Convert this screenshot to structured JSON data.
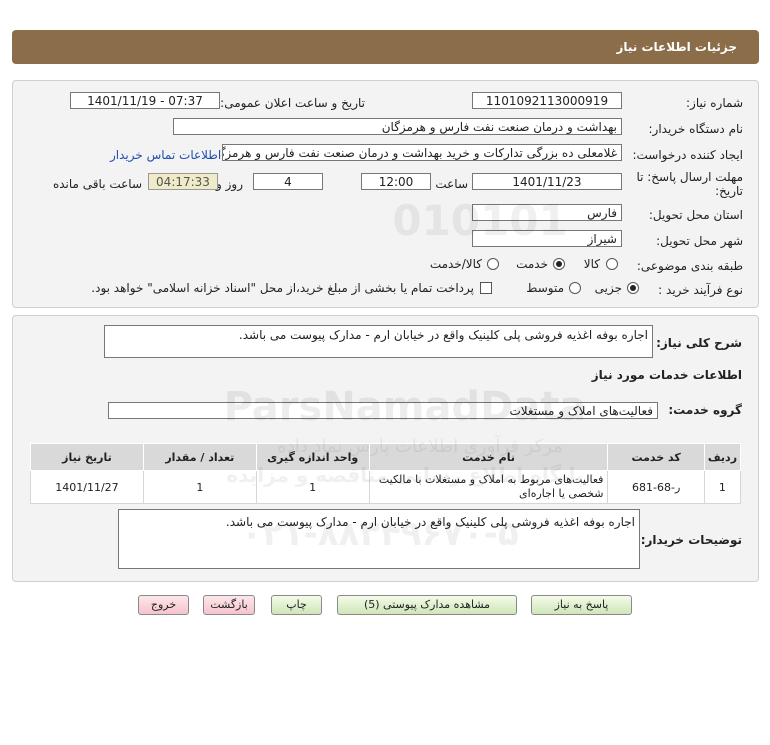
{
  "page": {
    "title": "جزئیات اطلاعات نیاز"
  },
  "form": {
    "need_number_label": "شماره نیاز:",
    "need_number": "1101092113000919",
    "announce_label": "تاریخ و ساعت اعلان عمومی:",
    "announce_value": "1401/11/19 - 07:37",
    "buyer_org_label": "نام دستگاه خریدار:",
    "buyer_org": "بهداشت و درمان صنعت نفت فارس و هرمزگان",
    "creator_label": "ایجاد کننده درخواست:",
    "creator": "غلامعلی ده بزرگی تدارکات و خرید بهداشت و درمان صنعت نفت فارس و هرمزگان",
    "contact_link": "اطلاعات تماس خریدار",
    "deadline_label_1": "مهلت ارسال پاسخ: تا",
    "deadline_label_2": "تاریخ:",
    "deadline_date": "1401/11/23",
    "time_label": "ساعت",
    "deadline_time": "12:00",
    "days_value": "4",
    "days_label": "روز و",
    "remaining_time": "04:17:33",
    "remaining_label": "ساعت باقی مانده",
    "province_label": "استان محل تحویل:",
    "province": "فارس",
    "city_label": "شهر محل تحویل:",
    "city": "شیراز",
    "category_label": "طبقه بندی موضوعی:",
    "category_options": [
      "کالا",
      "خدمت",
      "کالا/خدمت"
    ],
    "category_selected": "خدمت",
    "purchase_type_label": "نوع فرآیند خرید :",
    "purchase_type_options": [
      "جزیی",
      "متوسط"
    ],
    "purchase_type_selected": "جزیی",
    "payment_note": "پرداخت تمام یا بخشی از مبلغ خرید،از محل \"اسناد خزانه اسلامی\" خواهد بود."
  },
  "summary": {
    "label": "شرح کلی نیاز:",
    "text": "اجاره بوفه اغذیه فروشی پلی کلینیک واقع در خیابان ارم - مدارک پیوست می باشد.",
    "services_heading": "اطلاعات خدمات مورد نیاز",
    "service_group_label": "گروه خدمت:",
    "service_group": "فعالیت‌های  املاک و مستغلات"
  },
  "table": {
    "headers": [
      "ردیف",
      "کد خدمت",
      "نام خدمت",
      "واحد اندازه گیری",
      "تعداد / مقدار",
      "تاریخ نیاز"
    ],
    "rows": [
      [
        "1",
        "ر-68-681",
        "فعالیت‌های مربوط به املاک و مستغلات با مالکیت شخصی یا اجاره‌ای",
        "1",
        "1",
        "1401/11/27"
      ]
    ]
  },
  "buyer_notes": {
    "label": "توضیحات خریدار:",
    "text": "اجاره بوفه اغذیه فروشی پلی کلینیک واقع در خیابان ارم - مدارک پیوست می باشد."
  },
  "buttons": {
    "reply": "پاسخ به نیاز",
    "attachments": "مشاهده مدارک پیوستی (5)",
    "print": "چاپ",
    "back": "بازگشت",
    "exit": "خروج"
  },
  "watermark": {
    "brand": "ParsNamadData",
    "line1": "مرکز فرآوری اطلاعات پارس نماد داده",
    "line2": "پایگاه اطلاع رسانی مناقصه و مزایده",
    "phone": "۰۲۱-۸۸۳۴۹۶۷۰-۵",
    "digits": "010101"
  },
  "colors": {
    "header": "#8b6d4a",
    "link": "#1f4fb0",
    "button_green": "#cfe6b8",
    "button_red": "#f5c3cc"
  }
}
